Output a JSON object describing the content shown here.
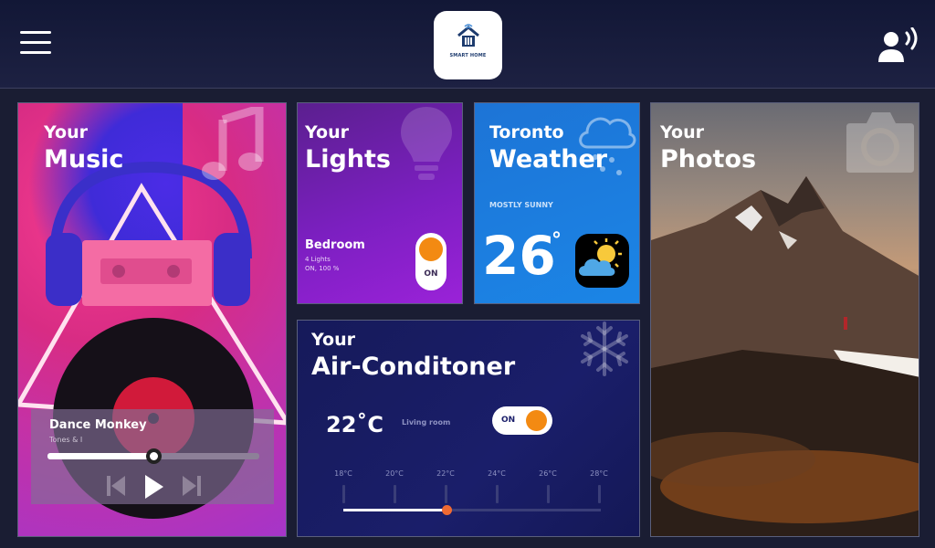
{
  "header": {
    "logo_text": "SMART HOME",
    "menu_icon": "hamburger-menu-icon",
    "voice_icon": "voice-user-icon"
  },
  "music": {
    "title_small": "Your",
    "title_big": "Music",
    "icon": "music-note-icon",
    "player": {
      "song": "Dance Monkey",
      "artist": "Tones & I",
      "progress": 0.5
    }
  },
  "lights": {
    "title_small": "Your",
    "title_big": "Lights",
    "icon": "light-bulb-icon",
    "room": "Bedroom",
    "count": "4 Lights",
    "status": "ON, 100 %",
    "toggle_label": "ON"
  },
  "weather": {
    "title_small": "Toronto",
    "title_big": "Weather",
    "icon": "cloud-rain-icon",
    "condition": "MOSTLY SUNNY",
    "temperature": "26",
    "unit": "°"
  },
  "photos": {
    "title_small": "Your",
    "title_big": "Photos",
    "icon": "camera-icon"
  },
  "ac": {
    "title_small": "Your",
    "title_big": "Air-Conditoner",
    "icon": "snowflake-icon",
    "temperature": "22˚C",
    "room": "Living room",
    "toggle_label": "ON",
    "scale": [
      "18°C",
      "20°C",
      "22°C",
      "24°C",
      "26°C",
      "28°C"
    ],
    "level": 0.4
  },
  "colors": {
    "accent_orange": "#f38a12",
    "lights_purple": "#7c1fc1",
    "weather_blue": "#1b85e6",
    "ac_navy": "#1a1e6a"
  }
}
